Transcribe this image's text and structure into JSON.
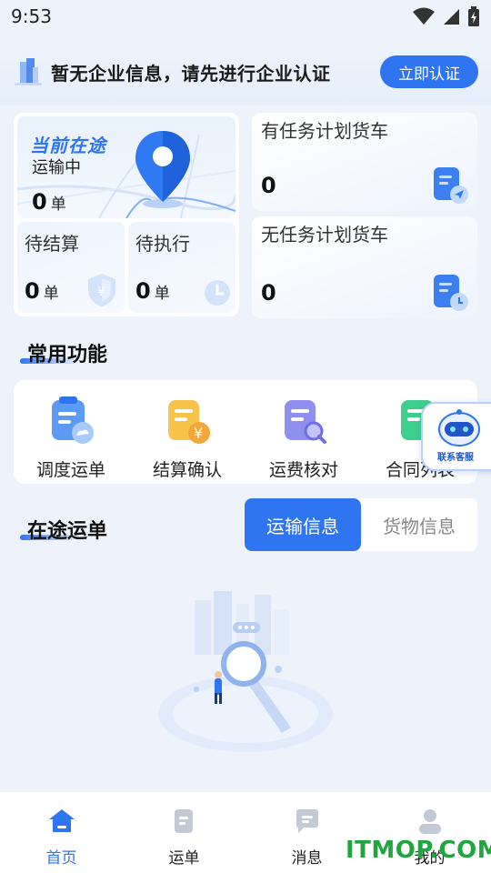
{
  "status_bar": {
    "time": "9:53",
    "icons": [
      "wifi-icon",
      "signal-icon",
      "battery-icon"
    ]
  },
  "banner": {
    "text": "暂无企业信息，请先进行企业认证",
    "button": "立即认证"
  },
  "cards": {
    "in_transit": {
      "title": "当前在途",
      "status": "运输中",
      "count": "0",
      "unit": "单"
    },
    "pending_settle": {
      "title": "待结算",
      "count": "0",
      "unit": "单"
    },
    "pending_exec": {
      "title": "待执行",
      "count": "0",
      "unit": "单"
    },
    "with_plan": {
      "title": "有任务计划货车",
      "count": "0"
    },
    "without_plan": {
      "title": "无任务计划货车",
      "count": "0"
    }
  },
  "common_functions": {
    "title": "常用功能",
    "items": [
      {
        "label": "调度运单",
        "icon": "dispatch-waybill-icon"
      },
      {
        "label": "结算确认",
        "icon": "settlement-confirm-icon"
      },
      {
        "label": "运费核对",
        "icon": "freight-check-icon"
      },
      {
        "label": "合同列表",
        "icon": "contract-list-icon"
      }
    ]
  },
  "customer_service": {
    "label": "联系客服"
  },
  "in_transit_orders": {
    "title": "在途运单",
    "tabs": [
      {
        "label": "运输信息",
        "active": true
      },
      {
        "label": "货物信息",
        "active": false
      }
    ]
  },
  "bottom_nav": [
    {
      "label": "首页",
      "icon": "home-icon",
      "active": true
    },
    {
      "label": "运单",
      "icon": "waybill-icon",
      "active": false
    },
    {
      "label": "消息",
      "icon": "message-icon",
      "active": false
    },
    {
      "label": "我的",
      "icon": "profile-icon",
      "active": false
    }
  ],
  "watermark": "ITMOP.COM",
  "colors": {
    "accent": "#2f74f0",
    "background": "#eef3fb",
    "watermark": "#22a53f"
  }
}
